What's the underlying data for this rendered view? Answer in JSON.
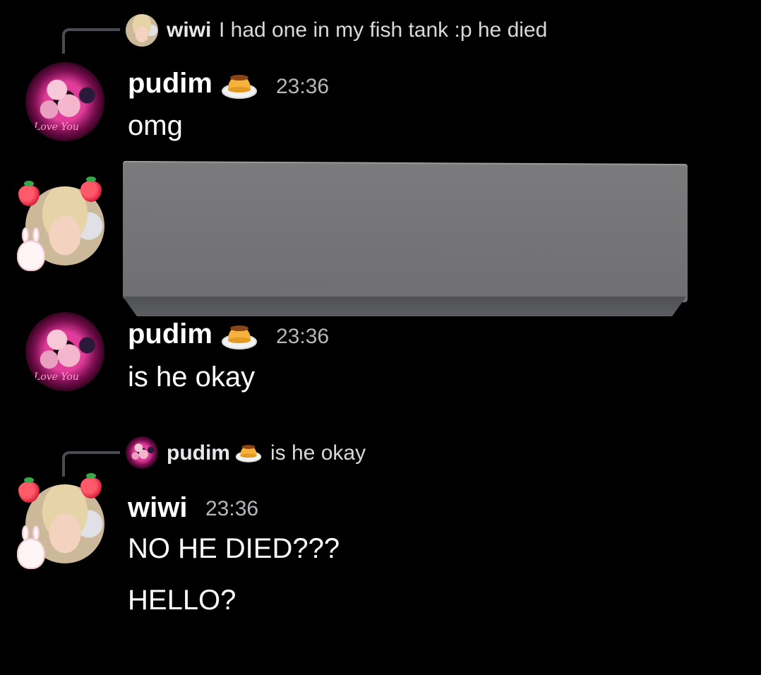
{
  "messages": [
    {
      "reply": {
        "author": "wiwi",
        "text": "I had one in my fish tank :p he died"
      },
      "author": "pudim",
      "author_emoji": "flan-pudding-emoji",
      "time": "23:36",
      "lines": [
        "omg"
      ],
      "avatar_caption": "Love You"
    },
    {
      "author": "wiwi",
      "attachment": "redacted-image-block"
    },
    {
      "author": "pudim",
      "author_emoji": "flan-pudding-emoji",
      "time": "23:36",
      "lines": [
        "is he okay"
      ],
      "avatar_caption": "Love You"
    },
    {
      "reply": {
        "author": "pudim",
        "author_emoji": "flan-pudding-emoji",
        "text": "is he okay"
      },
      "author": "wiwi",
      "time": "23:36",
      "lines": [
        "NO HE DIED???",
        "HELLO?"
      ]
    }
  ],
  "colors": {
    "background": "#000000",
    "timestamp": "#b5b7bd",
    "reply_line": "#4a4c52",
    "redaction": "#767678"
  }
}
